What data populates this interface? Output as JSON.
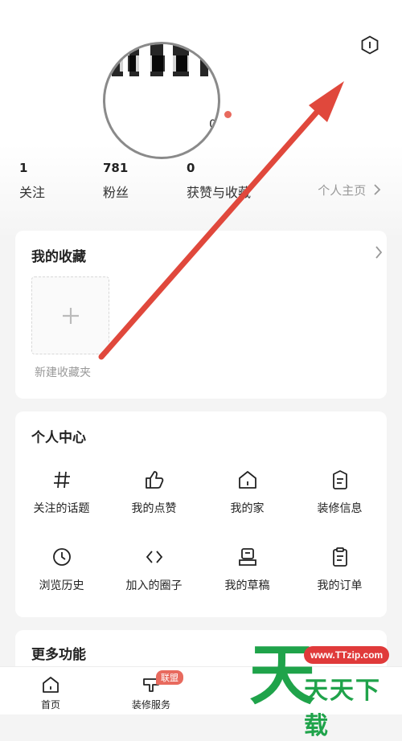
{
  "profile": {
    "avatar_overlay_text": "0",
    "stats": [
      {
        "count": "1",
        "label": "关注"
      },
      {
        "count": "781",
        "label": "粉丝"
      },
      {
        "count": "0",
        "label": "获赞与收藏"
      }
    ],
    "home_link": "个人主页"
  },
  "favorites": {
    "title": "我的收藏",
    "new_folder_label": "新建收藏夹"
  },
  "personal_center": {
    "title": "个人中心",
    "items": [
      {
        "label": "关注的话题",
        "icon": "hashtag-icon"
      },
      {
        "label": "我的点赞",
        "icon": "thumbs-up-icon"
      },
      {
        "label": "我的家",
        "icon": "house-icon"
      },
      {
        "label": "装修信息",
        "icon": "document-icon"
      },
      {
        "label": "浏览历史",
        "icon": "clock-icon"
      },
      {
        "label": "加入的圈子",
        "icon": "code-brackets-icon"
      },
      {
        "label": "我的草稿",
        "icon": "draft-icon"
      },
      {
        "label": "我的订单",
        "icon": "clipboard-icon"
      }
    ]
  },
  "more": {
    "title": "更多功能"
  },
  "tabbar": {
    "items": [
      {
        "label": "首页",
        "icon": "home-icon"
      },
      {
        "label": "装修服务",
        "icon": "service-icon"
      }
    ],
    "badge": "联盟"
  },
  "watermark": {
    "url": "www.TTzip.com",
    "text": "天天下载",
    "logo_char": "天"
  },
  "colors": {
    "accent": "#e86a5e",
    "arrow": "#e0483c",
    "watermark_green": "#1fa34a",
    "watermark_red": "#e03a3a"
  }
}
